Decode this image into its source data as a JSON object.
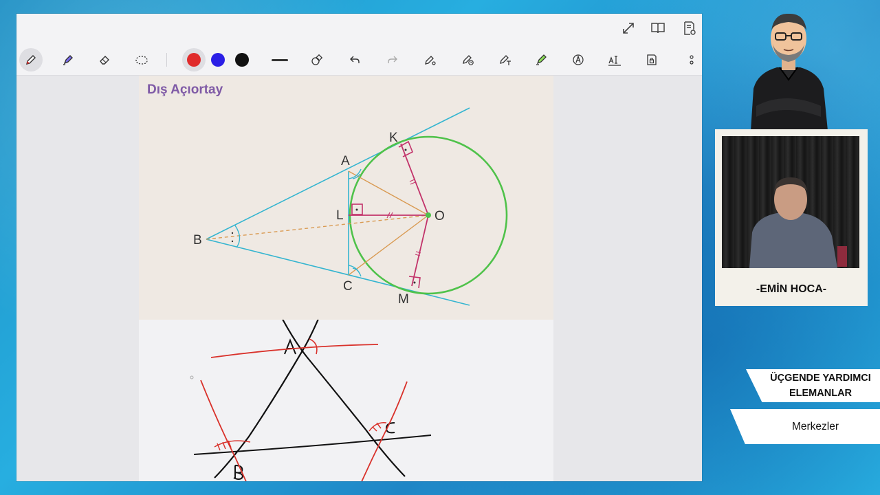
{
  "diagram": {
    "title": "Dış Açıortay",
    "labels": {
      "K": "K",
      "A": "A",
      "L": "L",
      "O": "O",
      "B": "B",
      "C": "C",
      "M": "M"
    }
  },
  "toolbar": {
    "tools": [
      "pen-tool",
      "highlighter-tool",
      "eraser-tool",
      "lasso-tool"
    ],
    "colors": [
      "#e02b2b",
      "#2b1fe6",
      "#111111"
    ],
    "selected_color": "#e02b2b"
  },
  "presenter": {
    "name": "-EMİN HOCA-"
  },
  "banner": {
    "title_line1": "ÜÇGENDE YARDIMCI",
    "title_line2": "ELEMANLAR",
    "subtitle": "Merkezler"
  }
}
